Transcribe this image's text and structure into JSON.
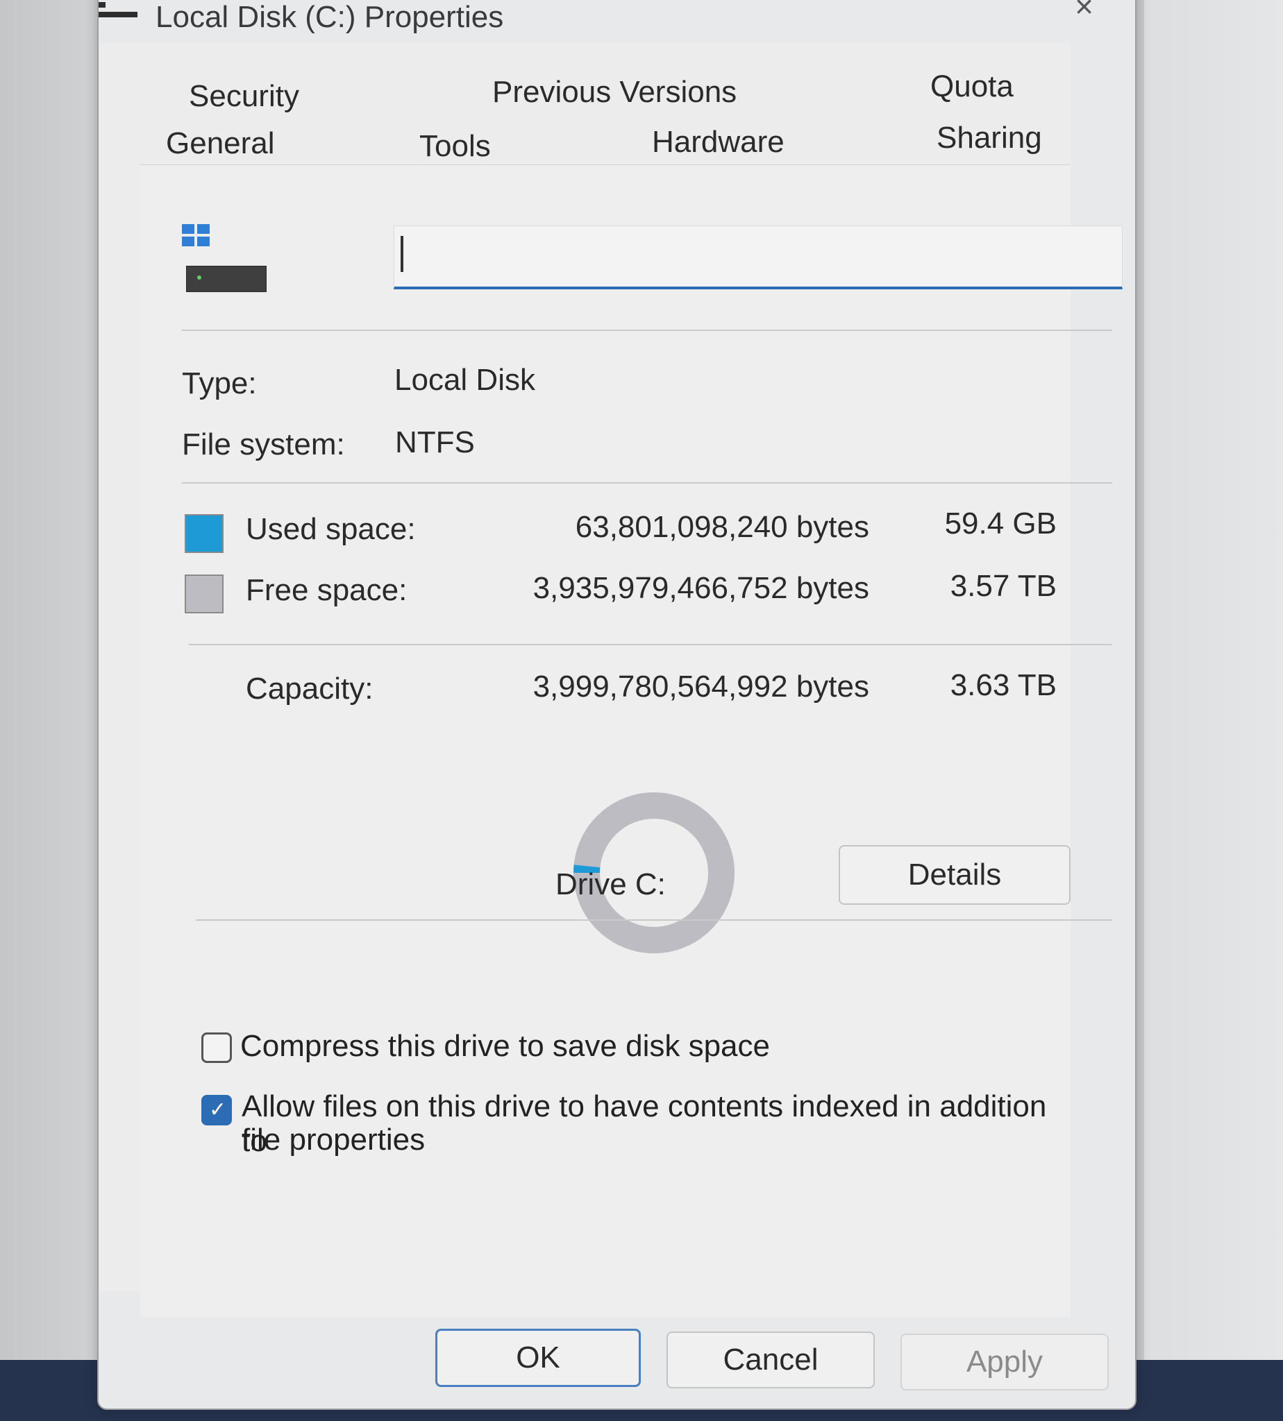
{
  "window": {
    "title": "Local Disk (C:) Properties",
    "close_glyph": "×"
  },
  "tabs": {
    "row1": [
      "Security",
      "Previous Versions",
      "Quota"
    ],
    "row2": [
      "General",
      "Tools",
      "Hardware",
      "Sharing"
    ],
    "active": "General"
  },
  "general": {
    "volume_name": "",
    "type_label": "Type:",
    "type_value": "Local Disk",
    "fs_label": "File system:",
    "fs_value": "NTFS",
    "used": {
      "label": "Used space:",
      "bytes": "63,801,098,240 bytes",
      "size": "59.4 GB",
      "color": "#1e9ad6"
    },
    "free": {
      "label": "Free space:",
      "bytes": "3,935,979,466,752 bytes",
      "size": "3.57 TB",
      "color": "#bcbcc2"
    },
    "capacity": {
      "label": "Capacity:",
      "bytes": "3,999,780,564,992 bytes",
      "size": "3.63 TB"
    },
    "used_fraction": 0.016,
    "drive_label": "Drive C:",
    "details_button": "Details",
    "compress_label": "Compress this drive to save disk space",
    "compress_checked": false,
    "index_label_line1": "Allow files on this drive to have contents indexed in addition to",
    "index_label_line2": "file properties",
    "index_checked": true
  },
  "buttons": {
    "ok": "OK",
    "cancel": "Cancel",
    "apply": "Apply"
  }
}
